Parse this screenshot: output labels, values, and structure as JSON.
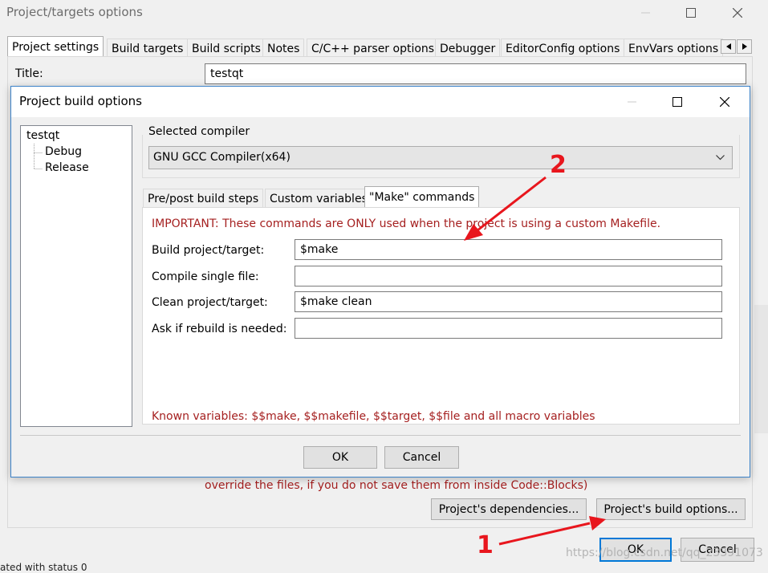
{
  "outer": {
    "title": "Project/targets options",
    "tabs": [
      {
        "label": "Project settings"
      },
      {
        "label": "Build targets"
      },
      {
        "label": "Build scripts"
      },
      {
        "label": "Notes"
      },
      {
        "label": "C/C++ parser options"
      },
      {
        "label": "Debugger"
      },
      {
        "label": "EditorConfig options"
      },
      {
        "label": "EnvVars options"
      }
    ],
    "title_label": "Title:",
    "title_value": "testqt",
    "warning_text": "override the files, if you do not save them from inside Code::Blocks)",
    "dependencies_button": "Project's dependencies...",
    "build_options_button": "Project's build options...",
    "ok_button": "OK",
    "cancel_button": "Cancel",
    "status_text": "ated with status 0"
  },
  "dialog": {
    "title": "Project build options",
    "tree": {
      "root": "testqt",
      "children": [
        {
          "label": "Debug"
        },
        {
          "label": "Release"
        }
      ]
    },
    "selected_compiler_label": "Selected compiler",
    "compiler_value": "GNU GCC Compiler(x64)",
    "tabs": [
      {
        "label": "Pre/post build steps"
      },
      {
        "label": "Custom variables"
      },
      {
        "label": "\"Make\" commands"
      }
    ],
    "important_text": "IMPORTANT: These commands are ONLY used when the project is using a custom Makefile.",
    "fields": [
      {
        "label": "Build project/target:",
        "value": "$make"
      },
      {
        "label": "Compile single file:",
        "value": ""
      },
      {
        "label": "Clean project/target:",
        "value": "$make clean"
      },
      {
        "label": "Ask if rebuild is needed:",
        "value": ""
      }
    ],
    "known_vars_text": "Known variables: $$make, $$makefile, $$target, $$file and all macro variables",
    "ok_button": "OK",
    "cancel_button": "Cancel"
  },
  "annotations": {
    "arrow1_number": "1",
    "arrow2_number": "2",
    "arrow_color": "#e8161d"
  },
  "watermark": "https://blog.csdn.net/qq_23391073",
  "colors": {
    "accent": "#3c82c8",
    "warning_red": "#a52020",
    "window_bg": "#f0f0f0"
  }
}
